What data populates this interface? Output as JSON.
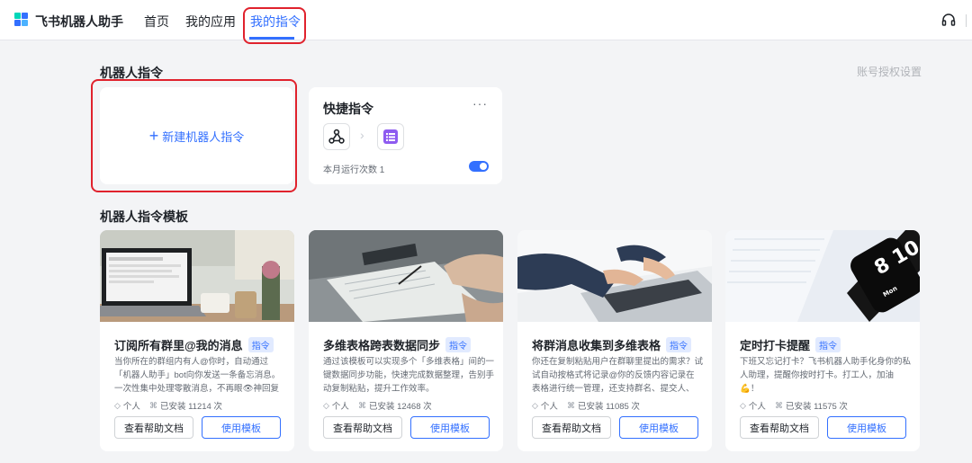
{
  "header": {
    "brand": "飞书机器人助手",
    "nav": [
      "首页",
      "我的应用",
      "我的指令"
    ],
    "active_nav": "我的指令"
  },
  "robot_commands": {
    "section_title": "机器人指令",
    "auth_link": "账号授权设置",
    "new_label": "新建机器人指令",
    "quick": {
      "title": "快捷指令",
      "more": "···",
      "runs_label": "本月运行次数 1",
      "enabled": true
    }
  },
  "templates": {
    "section_title": "机器人指令模板",
    "items": [
      {
        "title": "订阅所有群里@我的消息",
        "tag": "指令",
        "desc": "当你所在的群组内有人@你时，自动通过「机器人助手」bot向你发送一条备忘消息。一次性集中处理零散消息，不再眼👁神回复",
        "scope": "个人",
        "installs": "已安装 11214 次",
        "help_label": "查看帮助文档",
        "use_label": "使用模板"
      },
      {
        "title": "多维表格跨表数据同步",
        "tag": "指令",
        "desc": "通过该模板可以实现多个「多维表格」间的一键数据同步功能，快速完成数据整理，告别手动复制粘贴，提升工作效率。",
        "scope": "个人",
        "installs": "已安装 12468 次",
        "help_label": "查看帮助文档",
        "use_label": "使用模板"
      },
      {
        "title": "将群消息收集到多维表格",
        "tag": "指令",
        "desc": "你还在复制粘贴用户在群聊里提出的需求？试试自动按格式将记录@你的反馈内容记录在表格进行统一管理，还支持群名、提交人、提...",
        "scope": "个人",
        "installs": "已安装 11085 次",
        "help_label": "查看帮助文档",
        "use_label": "使用模板"
      },
      {
        "title": "定时打卡提醒",
        "tag": "指令",
        "desc": "下班又忘记打卡？飞书机器人助手化身你的私人助理，提醒你按时打卡。打工人，加油💪！",
        "scope": "个人",
        "installs": "已安装 11575 次",
        "help_label": "查看帮助文档",
        "use_label": "使用模板"
      }
    ]
  },
  "watch_face": {
    "time": "8 10",
    "day": "Mon"
  },
  "colors": {
    "accent": "#3370ff",
    "highlight": "#e0222d",
    "background": "#f3f4f6"
  }
}
